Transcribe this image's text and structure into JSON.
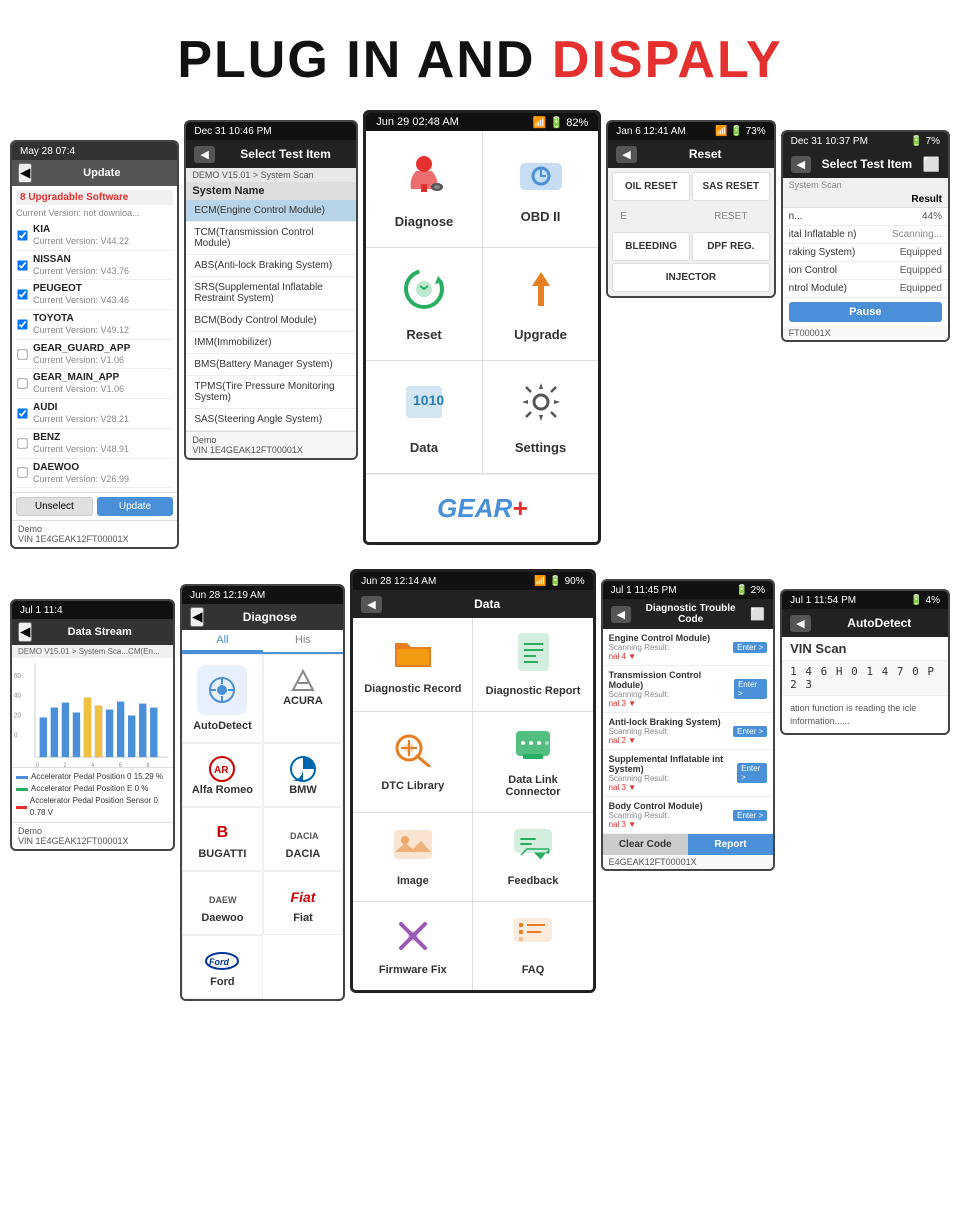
{
  "header": {
    "text_black": "PLUG IN AND ",
    "text_red": "DISPALY"
  },
  "top_row": {
    "update_screen": {
      "status_bar": "May 28  07:4",
      "toolbar_title": "Update",
      "upgrade_label": "8 Upgradable Software",
      "current_version_note": "Current Version: not downloa...",
      "items": [
        {
          "name": "KIA",
          "version": "Current Version: V44.22",
          "checked": true
        },
        {
          "name": "NISSAN",
          "version": "Current Version: V43.76",
          "checked": true
        },
        {
          "name": "PEUGEOT",
          "version": "Current Version: V43.46",
          "checked": true
        },
        {
          "name": "TOYOTA",
          "version": "Current Version: V49.12",
          "checked": true
        },
        {
          "name": "GEAR_GUARD_APP",
          "version": "Current Version: V1.06",
          "checked": false
        },
        {
          "name": "GEAR_MAIN_APP",
          "version": "Current Version: V1.06",
          "checked": false
        },
        {
          "name": "AUDI",
          "version": "Current Version: V28.21",
          "checked": true
        },
        {
          "name": "BENZ",
          "version": "Current Version: V48.91",
          "checked": false
        },
        {
          "name": "DAEWOO",
          "version": "Current Version: V26.99",
          "checked": false
        }
      ],
      "btn_unselect": "Unselect",
      "btn_update": "Update",
      "demo_label": "Demo",
      "vin": "VIN 1E4GEAK12FT00001X"
    },
    "select_test_screen": {
      "status_bar": "Dec 31  10:46 PM",
      "toolbar_title": "Select Test Item",
      "breadcrumb": "DEMO V15.01 > System Scan",
      "system_header": "System Name",
      "systems": [
        "ECM(Engine Control Module)",
        "TCM(Transmission Control Module)",
        "ABS(Anti-lock Braking System)",
        "SRS(Supplemental Inflatable Restraint System)",
        "BCM(Body Control Module)",
        "IMM(Immobilizer)",
        "BMS(Battery Manager System)",
        "TPMS(Tire Pressure Monitoring System)",
        "SAS(Steering Angle System)"
      ],
      "demo_label": "Demo",
      "vin": "VIN 1E4GEAK12FT00001X"
    },
    "diagnose_menu": {
      "status_bar": "Jun 29  02:48 AM",
      "wifi": "📶",
      "battery": "82%",
      "items": [
        {
          "label": "Diagnose",
          "icon": "car-red"
        },
        {
          "label": "OBD II",
          "icon": "obd-blue"
        },
        {
          "label": "Reset",
          "icon": "reset-green"
        },
        {
          "label": "Upgrade",
          "icon": "upgrade-orange"
        },
        {
          "label": "Data",
          "icon": "data-blue"
        },
        {
          "label": "Settings",
          "icon": "settings-gray"
        },
        {
          "label": "GEAR+",
          "icon": "gearplus"
        }
      ]
    },
    "reset_screen": {
      "status_bar": "Jan 6  12:41 AM",
      "wifi": "📶",
      "battery": "73%",
      "toolbar_title": "Reset",
      "items": [
        "OIL RESET",
        "SAS RESET",
        "BLEEDING",
        "DPF REG.",
        "INJECTOR"
      ]
    },
    "scan_result_screen": {
      "status_bar": "Dec 31  10:37 PM",
      "battery": "7%",
      "toolbar_title": "Select Test Item",
      "result_col": "Result",
      "rows": [
        {
          "name": "n...",
          "result": "44%",
          "type": "normal"
        },
        {
          "name": "ital Inflatable n)",
          "result": "Scanning...",
          "type": "scanning"
        },
        {
          "name": "raking System)",
          "result": "Equipped",
          "type": "normal"
        },
        {
          "name": "ion Control",
          "result": "Equipped",
          "type": "normal"
        },
        {
          "name": "ntrol Module)",
          "result": "Equipped",
          "type": "normal"
        }
      ],
      "pause_btn": "Pause",
      "vin": "FT00001X"
    }
  },
  "bottom_row": {
    "datastream_screen": {
      "status_bar": "Jul 1  11:4",
      "toolbar_title": "Data Stream",
      "breadcrumb": "DEMO V15.01 > System Sca...CM(En...",
      "legends": [
        {
          "color": "#4a90d9",
          "label": "Accelerator Pedal Position 0 15.29 %"
        },
        {
          "color": "#27ae60",
          "label": "Accelerator Pedal Position E 0 %"
        },
        {
          "color": "#e53030",
          "label": "Accelerator Pedal Position Sensor 0 0.78 V"
        }
      ],
      "demo_label": "Demo",
      "vin": "VIN 1E4GEAK12FT00001X"
    },
    "diagnose_brand_screen": {
      "status_bar": "Jun 28  12:19 AM",
      "toolbar_title": "Diagnose",
      "tab_all": "All",
      "tab_his": "His",
      "brands": [
        {
          "name": "AutoDetect",
          "has_icon": true
        },
        {
          "name": "ACURA",
          "has_icon": false
        },
        {
          "name": "Alfa Romeo",
          "has_icon": false
        },
        {
          "name": "BMW",
          "has_icon": false
        },
        {
          "name": "BUGATTI",
          "has_icon": false
        },
        {
          "name": "DACIA",
          "has_icon": false
        },
        {
          "name": "Daewoo",
          "has_icon": false
        },
        {
          "name": "Fiat",
          "has_icon": false
        },
        {
          "name": "Ford",
          "has_icon": false
        }
      ]
    },
    "data_center_screen": {
      "status_bar": "Jun 28  12:14 AM",
      "wifi": "📶",
      "battery": "90%",
      "toolbar_title": "Data",
      "items": [
        {
          "label": "Diagnostic Record",
          "icon": "folder"
        },
        {
          "label": "Diagnostic Report",
          "icon": "report"
        },
        {
          "label": "DTC Library",
          "icon": "dtc-lib"
        },
        {
          "label": "Data Link Connector",
          "icon": "dlc"
        },
        {
          "label": "Image",
          "icon": "image"
        },
        {
          "label": "Feedback",
          "icon": "feedback"
        },
        {
          "label": "Firmware Fix",
          "icon": "firmware"
        },
        {
          "label": "FAQ",
          "icon": "faq"
        }
      ]
    },
    "dtc_screen": {
      "status_bar": "Jul 1  11:45 PM",
      "battery": "2%",
      "toolbar_title": "Diagnostic Trouble Code",
      "rows": [
        {
          "name": "Engine Control Module)",
          "sub": "Scanning Result:",
          "signal": "Enter >"
        },
        {
          "name": "nal 4 ▼",
          "sub": "",
          "signal": ""
        },
        {
          "name": "Transmission Control Module)",
          "sub": "Scanning Result:",
          "signal": "Enter >"
        },
        {
          "name": "nal 3 ▼",
          "sub": "",
          "signal": ""
        },
        {
          "name": "Anti-lock Braking System)",
          "sub": "Scanning Result:",
          "signal": "Enter >"
        },
        {
          "name": "nal 2 ▼",
          "sub": "",
          "signal": ""
        },
        {
          "name": "Supplemental Inflatable int System)",
          "sub": "Scanning Result:",
          "signal": "Enter >"
        },
        {
          "name": "nal 3 ▼",
          "sub": "",
          "signal": ""
        },
        {
          "name": "Body Control Module)",
          "sub": "Scanning Result:",
          "signal": "Enter >"
        },
        {
          "name": "nal 3 ▼",
          "sub": "",
          "signal": ""
        }
      ],
      "btn_clear": "Clear Code",
      "btn_report": "Report",
      "vin": "E4GEAK12FT00001X"
    },
    "autodetect_screen": {
      "status_bar": "Jul 1  11:54 PM",
      "battery": "4%",
      "toolbar_title": "AutoDetect",
      "vin_scan_label": "VIN Scan",
      "vin_number": "1 4 6 H 0 1 4 7 0 P 2 3",
      "info_text": "ation function is reading the icle information......"
    }
  }
}
